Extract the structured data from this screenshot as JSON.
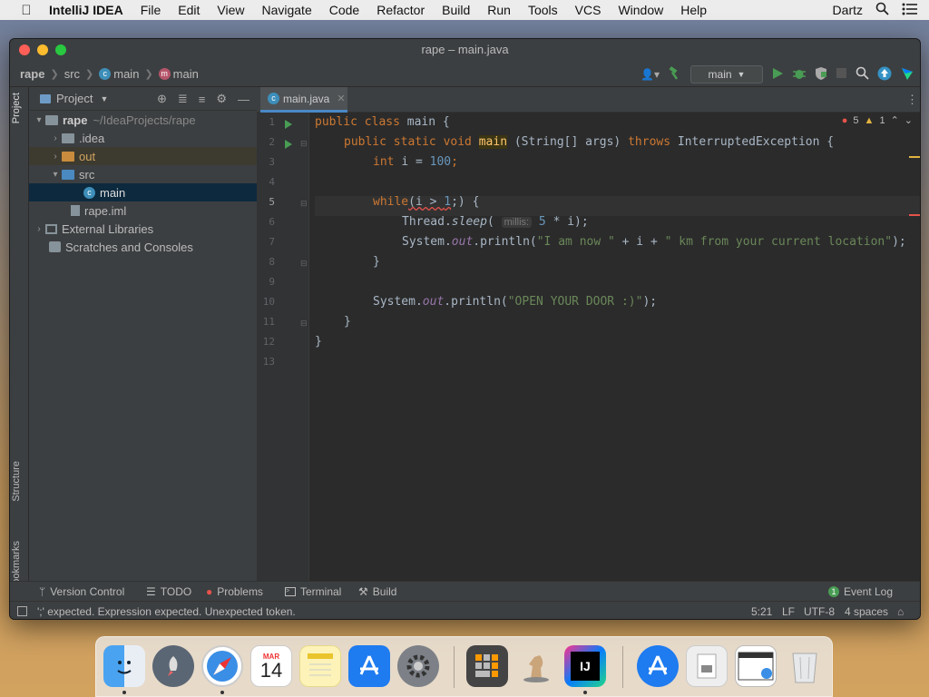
{
  "menubar": {
    "items": [
      "IntelliJ IDEA",
      "File",
      "Edit",
      "View",
      "Navigate",
      "Code",
      "Refactor",
      "Build",
      "Run",
      "Tools",
      "VCS",
      "Window",
      "Help"
    ],
    "user": "Dartz"
  },
  "window": {
    "title": "rape – main.java"
  },
  "breadcrumbs": [
    "rape",
    "src",
    "main",
    "main"
  ],
  "run_config": "main",
  "project_panel": {
    "title": "Project",
    "tree": [
      {
        "label": "rape",
        "path": "~/IdeaProjects/rape"
      },
      {
        "label": ".idea"
      },
      {
        "label": "out"
      },
      {
        "label": "src"
      },
      {
        "label": "main"
      },
      {
        "label": "rape.iml"
      },
      {
        "label": "External Libraries"
      },
      {
        "label": "Scratches and Consoles"
      }
    ]
  },
  "side_labels": {
    "project": "Project",
    "structure": "Structure",
    "bookmarks": "Bookmarks"
  },
  "editor": {
    "tab": "main.java",
    "errors": "5",
    "warnings": "1",
    "line_numbers": [
      "1",
      "2",
      "3",
      "4",
      "5",
      "6",
      "7",
      "8",
      "9",
      "10",
      "11",
      "12",
      "13"
    ],
    "code": {
      "l1_kw": "public class ",
      "l1_rest": "main {",
      "l2_kw": "public static void ",
      "l2_fn": "main",
      "l2_mid": " (String[] args) ",
      "l2_kw2": "throws ",
      "l2_rest": "InterruptedException {",
      "l3_kw": "int ",
      "l3_mid": "i = ",
      "l3_num": "100",
      "l3_end": ";",
      "l5_kw": "while",
      "l5_mid": "(i > ",
      "l5_num": "1",
      "l5_end": ";) {",
      "l6_a": "Thread.",
      "l6_fn": "sleep",
      "l6_b": "( ",
      "l6_hint": "millis:",
      "l6_num": " 5",
      "l6_c": " * i);",
      "l7_a": "System.",
      "l7_out": "out",
      "l7_b": ".println(",
      "l7_s1": "\"I am now \"",
      "l7_c": " + i + ",
      "l7_s2": "\" km from your current location\"",
      "l7_d": ");",
      "l8": "}",
      "l10_a": "System.",
      "l10_out": "out",
      "l10_b": ".println(",
      "l10_s": "\"OPEN YOUR DOOR :)\"",
      "l10_c": ");",
      "l11": "}",
      "l12": "}"
    }
  },
  "tool_windows": [
    "Version Control",
    "TODO",
    "Problems",
    "Terminal",
    "Build"
  ],
  "event_log": "Event Log",
  "status": {
    "message": "';' expected. Expression expected. Unexpected token.",
    "position": "5:21",
    "line_sep": "LF",
    "encoding": "UTF-8",
    "indent": "4 spaces"
  },
  "dock": {
    "calendar_month": "MAR",
    "calendar_day": "14",
    "intellij_label": "IJ"
  },
  "colors": {
    "accent": "#4a88c7",
    "error": "#e5534b",
    "warning": "#e3b341",
    "run": "#499c54"
  }
}
